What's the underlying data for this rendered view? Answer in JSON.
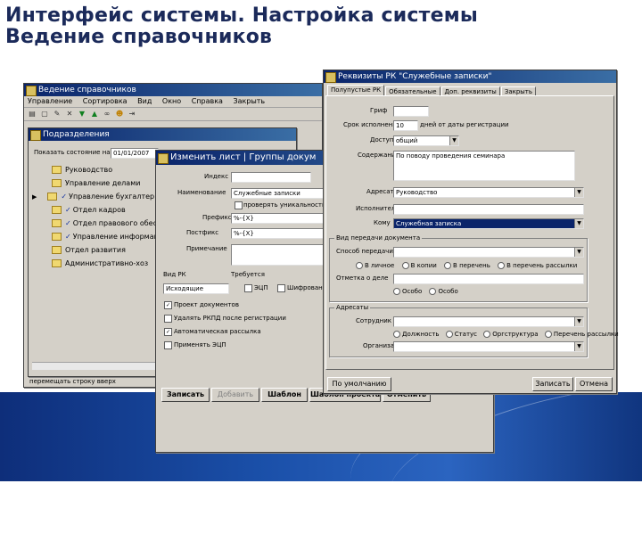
{
  "slide": {
    "title_line1": "Интерфейс системы. Настройка системы",
    "title_line2": "Ведение справочников"
  },
  "main_window": {
    "title": "Ведение справочников",
    "menu": [
      "Управление",
      "Сортировка",
      "Вид",
      "Окно",
      "Справка",
      "Закрыть"
    ],
    "toolbar_icons": [
      "print-icon",
      "new-icon",
      "edit-icon",
      "delete-icon",
      "move-down-icon",
      "move-up-icon",
      "binoculars-icon",
      "user-icon",
      "exit-icon"
    ]
  },
  "dept_window": {
    "title": "Подразделения",
    "date_label": "Показать состояние на",
    "date_value": "01/01/2007",
    "items": [
      {
        "label": "Руководство",
        "checked": false,
        "arrow": false
      },
      {
        "label": "Управление делами",
        "checked": false,
        "arrow": false
      },
      {
        "label": "Управление бухгалтер",
        "checked": true,
        "arrow": true
      },
      {
        "label": "Отдел кадров",
        "checked": true,
        "arrow": false
      },
      {
        "label": "Отдел правового обес",
        "checked": true,
        "arrow": false
      },
      {
        "label": "Управление информац",
        "checked": true,
        "arrow": false
      },
      {
        "label": "Отдел развития",
        "checked": false,
        "arrow": false
      },
      {
        "label": "Административно-хоз",
        "checked": false,
        "arrow": false
      }
    ],
    "status": "перемещать строку вверх"
  },
  "edit_window": {
    "title": "Изменить лист | Группы докум",
    "labels": {
      "index": "Индекс",
      "name": "Наименование",
      "prefix": "Префикс",
      "postfix": "Постфикс",
      "note": "Примечание",
      "rk_type": "Вид РК",
      "requires": "Требуется"
    },
    "values": {
      "name": "Служебные записки",
      "prefix": "%-{X}",
      "postfix": "%-{X}",
      "rk_type": "Исходящие"
    },
    "unique_check": "проверять уникальность",
    "eds_check": "ЭЦП",
    "encrypt_check": "Шифрование",
    "options": [
      {
        "label": "Проект документов",
        "checked": true
      },
      {
        "label": "Удалять РКПД после регистрации",
        "checked": false
      },
      {
        "label": "Автоматическая рассылка",
        "checked": true
      },
      {
        "label": "Применять ЭЦП",
        "checked": false
      }
    ],
    "buttons": [
      "Записать",
      "Добавить",
      "Шаблон",
      "Шаблон проекта",
      "Отменить"
    ]
  },
  "rk_window": {
    "title": "Реквизиты РК \"Служебные записки\"",
    "tabs": [
      "Полупустые РК",
      "Обязательные",
      "Доп. реквизиты",
      "Закрыть"
    ],
    "labels": {
      "sign": "Гриф",
      "exec_term": "Срок исполнения",
      "access": "Доступ",
      "content": "Содержание",
      "addressee": "Адресат",
      "executor": "Исполнитель",
      "whose": "Кому",
      "view_group": "Вид передачи документа",
      "view_type": "Способ передачи",
      "control": "Отметка о деле",
      "addressees": "Адресаты",
      "employee": "Сотрудник",
      "organization": "Организация"
    },
    "values": {
      "exec_term": "10",
      "exec_term_note": "дней от даты регистрации",
      "access": "общий",
      "content": "По поводу проведения семинара",
      "addressee": "Руководство",
      "whose": "Служебная записка"
    },
    "view_radios": [
      "В личное",
      "В копии",
      "В перечень",
      "В перечень рассылки"
    ],
    "control_radios": [
      "Особо",
      "Особо"
    ],
    "addr_radios": [
      "Должность",
      "Статус",
      "Оргструктура",
      "Перечень рассылки"
    ],
    "buttons": [
      "По умолчанию",
      "Записать",
      "Отмена"
    ]
  }
}
